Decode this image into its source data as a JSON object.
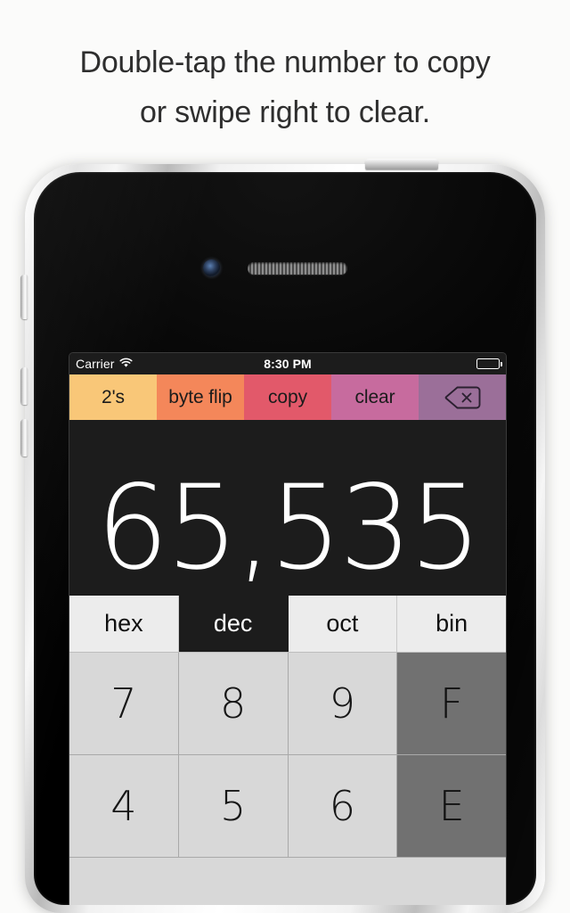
{
  "caption": {
    "line1": "Double-tap the number to copy",
    "line2": "or swipe right to clear."
  },
  "colors": {
    "page_background": "#FBFBFA",
    "screen_background": "#1C1C1C",
    "toolbar_twos": "#F9C778",
    "toolbar_byteflip": "#F4875A",
    "toolbar_copy": "#E2596A",
    "toolbar_clear": "#C76B9E",
    "toolbar_delete": "#9B6F99",
    "key_background": "#D8D8D8",
    "key_disabled": "#717171",
    "base_background": "#ECECEC",
    "display_text": "#FFFFFF"
  },
  "status_bar": {
    "carrier": "Carrier",
    "wifi_icon": "wifi-icon",
    "time": "8:30 PM",
    "battery_icon": "battery-full-icon"
  },
  "toolbar": {
    "buttons": [
      {
        "label": "2's",
        "name": "twos-complement-button",
        "color": "#F9C778",
        "icon": ""
      },
      {
        "label": "byte flip",
        "name": "byte-flip-button",
        "color": "#F4875A",
        "icon": ""
      },
      {
        "label": "copy",
        "name": "copy-button",
        "color": "#E2596A",
        "icon": ""
      },
      {
        "label": "clear",
        "name": "clear-button",
        "color": "#C76B9E",
        "icon": ""
      },
      {
        "label": "",
        "name": "delete-button",
        "color": "#9B6F99",
        "icon": "delete-backspace-icon"
      }
    ]
  },
  "display": {
    "value": "65,535",
    "base": "dec"
  },
  "bases": {
    "selected": "dec",
    "items": [
      {
        "label": "hex",
        "selected": false
      },
      {
        "label": "dec",
        "selected": true
      },
      {
        "label": "oct",
        "selected": false
      },
      {
        "label": "bin",
        "selected": false
      }
    ]
  },
  "keypad": {
    "rows": [
      [
        {
          "label": "7",
          "disabled": false
        },
        {
          "label": "8",
          "disabled": false
        },
        {
          "label": "9",
          "disabled": false
        },
        {
          "label": "F",
          "disabled": true
        }
      ],
      [
        {
          "label": "4",
          "disabled": false
        },
        {
          "label": "5",
          "disabled": false
        },
        {
          "label": "6",
          "disabled": false
        },
        {
          "label": "E",
          "disabled": true
        }
      ]
    ]
  },
  "device": {
    "camera_icon": "front-camera-icon",
    "earpiece_icon": "earpiece-speaker-icon",
    "power_button": "power-button",
    "ring_switch": "ring-silent-switch",
    "volume_up": "volume-up-button",
    "volume_down": "volume-down-button"
  }
}
